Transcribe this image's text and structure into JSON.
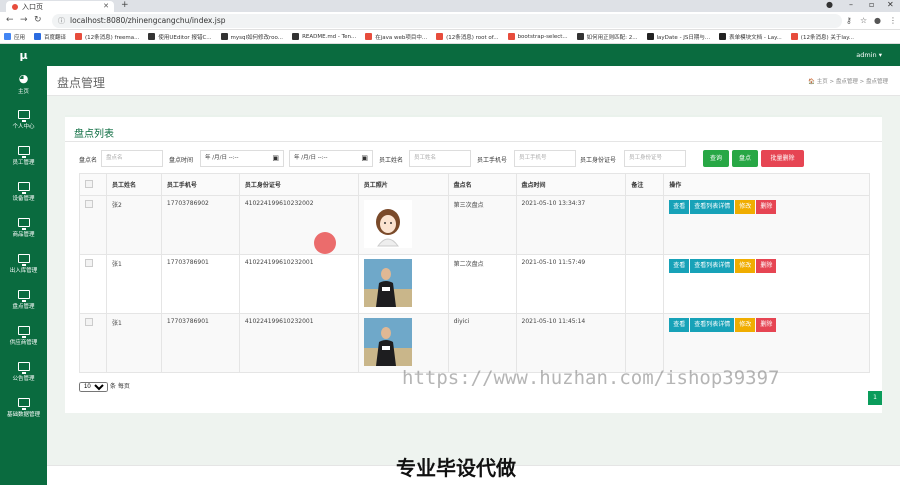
{
  "browser": {
    "tab_title": "入口页",
    "url": "localhost:8080/zhinengcangchu/index.jsp",
    "bookmarks": [
      {
        "label": "应用",
        "color": "#4285f4"
      },
      {
        "label": "百度翻译",
        "color": "#2a6be0"
      },
      {
        "label": "(12条消息) freema...",
        "color": "#e74c3c"
      },
      {
        "label": "使用UEditor 报错C...",
        "color": "#333333"
      },
      {
        "label": "mysql如何修改roo...",
        "color": "#333333"
      },
      {
        "label": "README.md - Ten...",
        "color": "#333333"
      },
      {
        "label": "在java web项目中...",
        "color": "#e74c3c"
      },
      {
        "label": "(12条消息) root of...",
        "color": "#e74c3c"
      },
      {
        "label": "bootstrap-select...",
        "color": "#e74c3c"
      },
      {
        "label": "如何用正则匹配: 2...",
        "color": "#333333"
      },
      {
        "label": "layDate - JS日期与...",
        "color": "#222222"
      },
      {
        "label": "表单模块文档 - Lay...",
        "color": "#222222"
      },
      {
        "label": "(12条消息) 关于lay...",
        "color": "#e74c3c"
      }
    ]
  },
  "app": {
    "logo": "μ",
    "user": "admin ▾",
    "sidebar": [
      {
        "label": "主页",
        "icon": "dashboard-icon"
      },
      {
        "label": "个人中心",
        "icon": "monitor-icon"
      },
      {
        "label": "员工管理",
        "icon": "monitor-icon"
      },
      {
        "label": "设备管理",
        "icon": "monitor-icon"
      },
      {
        "label": "商品管理",
        "icon": "monitor-icon"
      },
      {
        "label": "出入库管理",
        "icon": "monitor-icon"
      },
      {
        "label": "盘点管理",
        "icon": "monitor-icon"
      },
      {
        "label": "供应商管理",
        "icon": "monitor-icon"
      },
      {
        "label": "公告管理",
        "icon": "monitor-icon"
      },
      {
        "label": "基础数据管理",
        "icon": "monitor-icon"
      }
    ],
    "page_title": "盘点管理",
    "breadcrumb": "🏠 主页  >  盘点管理  >  盘点管理",
    "panel_title": "盘点列表",
    "search": {
      "name_label": "盘点名",
      "name_placeholder": "盘点名",
      "time_label": "盘点时间",
      "date_placeholder": "年 /月/日  --:--",
      "emp_name_label": "员工姓名",
      "emp_name_placeholder": "员工姓名",
      "emp_phone_label": "员工手机号",
      "emp_phone_placeholder": "员工手机号",
      "emp_id_label": "员工身份证号",
      "emp_id_placeholder": "员工身份证号",
      "query_btn": "查询",
      "add_btn": "盘点",
      "batch_delete_btn": "批量删除"
    },
    "table": {
      "headers": [
        "员工姓名",
        "员工手机号",
        "员工身份证号",
        "员工照片",
        "盘点名",
        "盘点时间",
        "备注",
        "操作"
      ],
      "rows": [
        {
          "name": "张2",
          "phone": "17703786902",
          "idcard": "410224199610232002",
          "photo": "cartoon",
          "title": "第三次盘点",
          "time": "2021-05-10 13:34:37",
          "note": ""
        },
        {
          "name": "张1",
          "phone": "17703786901",
          "idcard": "410224199610232001",
          "photo": "man",
          "title": "第二次盘点",
          "time": "2021-05-10 11:57:49",
          "note": ""
        },
        {
          "name": "张1",
          "phone": "17703786901",
          "idcard": "410224199610232001",
          "photo": "man",
          "title": "diyici",
          "time": "2021-05-10 11:45:14",
          "note": ""
        }
      ],
      "actions": {
        "view": "查看",
        "detail": "查看列表详情",
        "edit": "修改",
        "delete": "删除"
      }
    },
    "page_size": "10",
    "page_size_suffix": "条 每页",
    "current_page": "1"
  },
  "watermark": "https://www.huzhan.com/ishop39397",
  "overlay_text": "专业毕设代做",
  "colors": {
    "brand": "#0a6b3f",
    "info": "#17a2b8",
    "warning": "#f0ad00",
    "danger": "#e64553",
    "success": "#28a745"
  }
}
